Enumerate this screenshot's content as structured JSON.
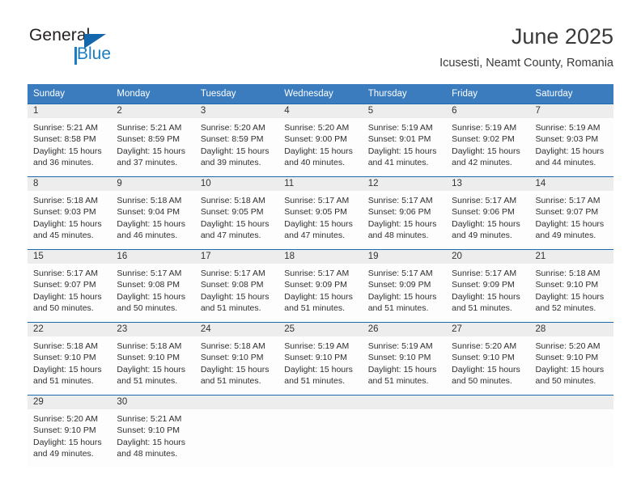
{
  "brand": {
    "name_top": "General",
    "name_bottom": "Blue",
    "triangle_color": "#1567ac",
    "blue_color": "#1b7dc4",
    "dark_color": "#231f20"
  },
  "header": {
    "title": "June 2025",
    "subtitle": "Icusesti, Neamt County, Romania"
  },
  "theme": {
    "header_bg": "#3a7cbe",
    "header_text": "#ffffff",
    "row_divider": "#1a6aad",
    "daynum_band_bg": "#ededed",
    "cell_bg": "#fdfdfd"
  },
  "weekdays": [
    "Sunday",
    "Monday",
    "Tuesday",
    "Wednesday",
    "Thursday",
    "Friday",
    "Saturday"
  ],
  "weeks": [
    [
      {
        "day": "1",
        "sunrise": "Sunrise: 5:21 AM",
        "sunset": "Sunset: 8:58 PM",
        "daylight1": "Daylight: 15 hours",
        "daylight2": "and 36 minutes."
      },
      {
        "day": "2",
        "sunrise": "Sunrise: 5:21 AM",
        "sunset": "Sunset: 8:59 PM",
        "daylight1": "Daylight: 15 hours",
        "daylight2": "and 37 minutes."
      },
      {
        "day": "3",
        "sunrise": "Sunrise: 5:20 AM",
        "sunset": "Sunset: 8:59 PM",
        "daylight1": "Daylight: 15 hours",
        "daylight2": "and 39 minutes."
      },
      {
        "day": "4",
        "sunrise": "Sunrise: 5:20 AM",
        "sunset": "Sunset: 9:00 PM",
        "daylight1": "Daylight: 15 hours",
        "daylight2": "and 40 minutes."
      },
      {
        "day": "5",
        "sunrise": "Sunrise: 5:19 AM",
        "sunset": "Sunset: 9:01 PM",
        "daylight1": "Daylight: 15 hours",
        "daylight2": "and 41 minutes."
      },
      {
        "day": "6",
        "sunrise": "Sunrise: 5:19 AM",
        "sunset": "Sunset: 9:02 PM",
        "daylight1": "Daylight: 15 hours",
        "daylight2": "and 42 minutes."
      },
      {
        "day": "7",
        "sunrise": "Sunrise: 5:19 AM",
        "sunset": "Sunset: 9:03 PM",
        "daylight1": "Daylight: 15 hours",
        "daylight2": "and 44 minutes."
      }
    ],
    [
      {
        "day": "8",
        "sunrise": "Sunrise: 5:18 AM",
        "sunset": "Sunset: 9:03 PM",
        "daylight1": "Daylight: 15 hours",
        "daylight2": "and 45 minutes."
      },
      {
        "day": "9",
        "sunrise": "Sunrise: 5:18 AM",
        "sunset": "Sunset: 9:04 PM",
        "daylight1": "Daylight: 15 hours",
        "daylight2": "and 46 minutes."
      },
      {
        "day": "10",
        "sunrise": "Sunrise: 5:18 AM",
        "sunset": "Sunset: 9:05 PM",
        "daylight1": "Daylight: 15 hours",
        "daylight2": "and 47 minutes."
      },
      {
        "day": "11",
        "sunrise": "Sunrise: 5:17 AM",
        "sunset": "Sunset: 9:05 PM",
        "daylight1": "Daylight: 15 hours",
        "daylight2": "and 47 minutes."
      },
      {
        "day": "12",
        "sunrise": "Sunrise: 5:17 AM",
        "sunset": "Sunset: 9:06 PM",
        "daylight1": "Daylight: 15 hours",
        "daylight2": "and 48 minutes."
      },
      {
        "day": "13",
        "sunrise": "Sunrise: 5:17 AM",
        "sunset": "Sunset: 9:06 PM",
        "daylight1": "Daylight: 15 hours",
        "daylight2": "and 49 minutes."
      },
      {
        "day": "14",
        "sunrise": "Sunrise: 5:17 AM",
        "sunset": "Sunset: 9:07 PM",
        "daylight1": "Daylight: 15 hours",
        "daylight2": "and 49 minutes."
      }
    ],
    [
      {
        "day": "15",
        "sunrise": "Sunrise: 5:17 AM",
        "sunset": "Sunset: 9:07 PM",
        "daylight1": "Daylight: 15 hours",
        "daylight2": "and 50 minutes."
      },
      {
        "day": "16",
        "sunrise": "Sunrise: 5:17 AM",
        "sunset": "Sunset: 9:08 PM",
        "daylight1": "Daylight: 15 hours",
        "daylight2": "and 50 minutes."
      },
      {
        "day": "17",
        "sunrise": "Sunrise: 5:17 AM",
        "sunset": "Sunset: 9:08 PM",
        "daylight1": "Daylight: 15 hours",
        "daylight2": "and 51 minutes."
      },
      {
        "day": "18",
        "sunrise": "Sunrise: 5:17 AM",
        "sunset": "Sunset: 9:09 PM",
        "daylight1": "Daylight: 15 hours",
        "daylight2": "and 51 minutes."
      },
      {
        "day": "19",
        "sunrise": "Sunrise: 5:17 AM",
        "sunset": "Sunset: 9:09 PM",
        "daylight1": "Daylight: 15 hours",
        "daylight2": "and 51 minutes."
      },
      {
        "day": "20",
        "sunrise": "Sunrise: 5:17 AM",
        "sunset": "Sunset: 9:09 PM",
        "daylight1": "Daylight: 15 hours",
        "daylight2": "and 51 minutes."
      },
      {
        "day": "21",
        "sunrise": "Sunrise: 5:18 AM",
        "sunset": "Sunset: 9:10 PM",
        "daylight1": "Daylight: 15 hours",
        "daylight2": "and 52 minutes."
      }
    ],
    [
      {
        "day": "22",
        "sunrise": "Sunrise: 5:18 AM",
        "sunset": "Sunset: 9:10 PM",
        "daylight1": "Daylight: 15 hours",
        "daylight2": "and 51 minutes."
      },
      {
        "day": "23",
        "sunrise": "Sunrise: 5:18 AM",
        "sunset": "Sunset: 9:10 PM",
        "daylight1": "Daylight: 15 hours",
        "daylight2": "and 51 minutes."
      },
      {
        "day": "24",
        "sunrise": "Sunrise: 5:18 AM",
        "sunset": "Sunset: 9:10 PM",
        "daylight1": "Daylight: 15 hours",
        "daylight2": "and 51 minutes."
      },
      {
        "day": "25",
        "sunrise": "Sunrise: 5:19 AM",
        "sunset": "Sunset: 9:10 PM",
        "daylight1": "Daylight: 15 hours",
        "daylight2": "and 51 minutes."
      },
      {
        "day": "26",
        "sunrise": "Sunrise: 5:19 AM",
        "sunset": "Sunset: 9:10 PM",
        "daylight1": "Daylight: 15 hours",
        "daylight2": "and 51 minutes."
      },
      {
        "day": "27",
        "sunrise": "Sunrise: 5:20 AM",
        "sunset": "Sunset: 9:10 PM",
        "daylight1": "Daylight: 15 hours",
        "daylight2": "and 50 minutes."
      },
      {
        "day": "28",
        "sunrise": "Sunrise: 5:20 AM",
        "sunset": "Sunset: 9:10 PM",
        "daylight1": "Daylight: 15 hours",
        "daylight2": "and 50 minutes."
      }
    ],
    [
      {
        "day": "29",
        "sunrise": "Sunrise: 5:20 AM",
        "sunset": "Sunset: 9:10 PM",
        "daylight1": "Daylight: 15 hours",
        "daylight2": "and 49 minutes."
      },
      {
        "day": "30",
        "sunrise": "Sunrise: 5:21 AM",
        "sunset": "Sunset: 9:10 PM",
        "daylight1": "Daylight: 15 hours",
        "daylight2": "and 48 minutes."
      },
      {
        "day": "",
        "sunrise": "",
        "sunset": "",
        "daylight1": "",
        "daylight2": ""
      },
      {
        "day": "",
        "sunrise": "",
        "sunset": "",
        "daylight1": "",
        "daylight2": ""
      },
      {
        "day": "",
        "sunrise": "",
        "sunset": "",
        "daylight1": "",
        "daylight2": ""
      },
      {
        "day": "",
        "sunrise": "",
        "sunset": "",
        "daylight1": "",
        "daylight2": ""
      },
      {
        "day": "",
        "sunrise": "",
        "sunset": "",
        "daylight1": "",
        "daylight2": ""
      }
    ]
  ]
}
